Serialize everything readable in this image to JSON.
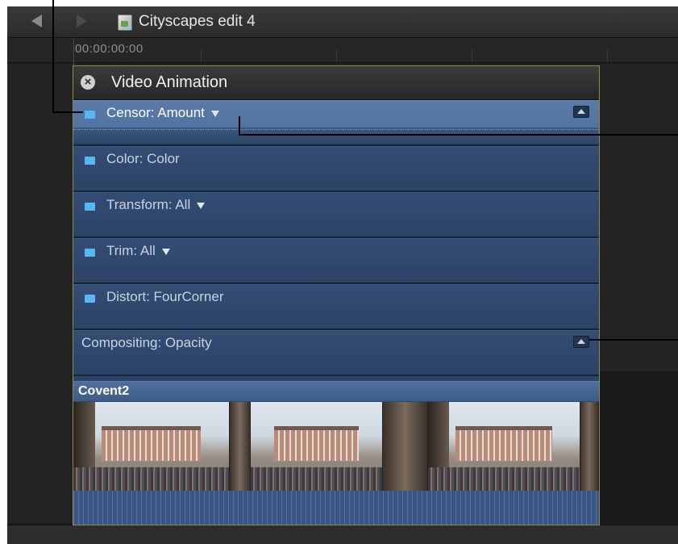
{
  "window": {
    "project_title": "Cityscapes edit 4",
    "timecode": "00:00:00:00"
  },
  "animation_editor": {
    "title": "Video Animation",
    "rows": [
      {
        "label": "Censor: Amount",
        "has_swatch": true,
        "has_menu": true,
        "selected": true,
        "collapse": true
      },
      {
        "label": "Color: Color",
        "has_swatch": true,
        "has_menu": false,
        "selected": false,
        "collapse": false
      },
      {
        "label": "Transform: All",
        "has_swatch": true,
        "has_menu": true,
        "selected": false,
        "collapse": false
      },
      {
        "label": "Trim: All",
        "has_swatch": true,
        "has_menu": true,
        "selected": false,
        "collapse": false
      },
      {
        "label": "Distort: FourCorner",
        "has_swatch": true,
        "has_menu": false,
        "selected": false,
        "collapse": false
      },
      {
        "label": "Compositing: Opacity",
        "has_swatch": false,
        "has_menu": false,
        "selected": false,
        "collapse": true
      }
    ]
  },
  "clip": {
    "name": "Covent2"
  },
  "icons": {
    "back": "back-arrow-icon",
    "forward": "forward-arrow-icon",
    "project": "project-document-icon",
    "close": "close-icon",
    "effect_swatch": "effect-swatch-icon",
    "menu": "disclosure-triangle-icon",
    "collapse": "collapse-icon"
  },
  "colors": {
    "row_bg": "#2c4366",
    "row_selected": "#5a7ba8",
    "swatch": "#5ab6f2",
    "panel_border": "#8a8a4a"
  }
}
